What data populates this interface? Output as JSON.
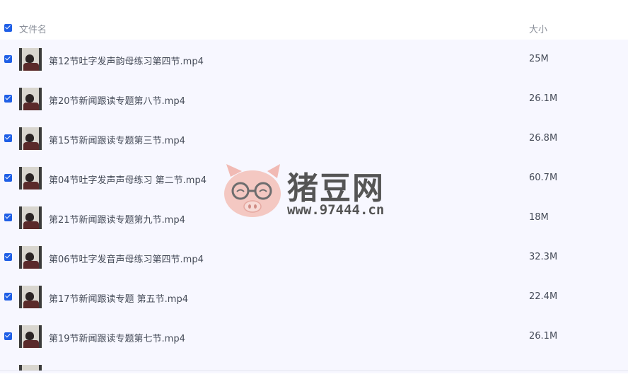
{
  "header": {
    "name_label": "文件名",
    "size_label": "大小"
  },
  "files": [
    {
      "name": "第12节吐字发声韵母练习第四节.mp4",
      "size": "25M",
      "checked": true
    },
    {
      "name": "第20节新闻跟读专题第八节.mp4",
      "size": "26.1M",
      "checked": true
    },
    {
      "name": "第15节新闻跟读专题第三节.mp4",
      "size": "26.8M",
      "checked": true
    },
    {
      "name": "第04节吐字发声声母练习 第二节.mp4",
      "size": "60.7M",
      "checked": true
    },
    {
      "name": "第21节新闻跟读专题第九节.mp4",
      "size": "18M",
      "checked": true
    },
    {
      "name": "第06节吐字发音声母练习第四节.mp4",
      "size": "32.3M",
      "checked": true
    },
    {
      "name": "第17节新闻跟读专题 第五节.mp4",
      "size": "22.4M",
      "checked": true
    },
    {
      "name": "第19节新闻跟读专题第七节.mp4",
      "size": "26.1M",
      "checked": true
    }
  ],
  "watermark": {
    "title": "猪豆网",
    "url": "www.97444.cn",
    "icon": "pig-mascot-icon"
  },
  "colors": {
    "checkbox": "#1f5fe6",
    "list_background": "#f7f7ff",
    "watermark_pig": "#f0b0a8"
  }
}
